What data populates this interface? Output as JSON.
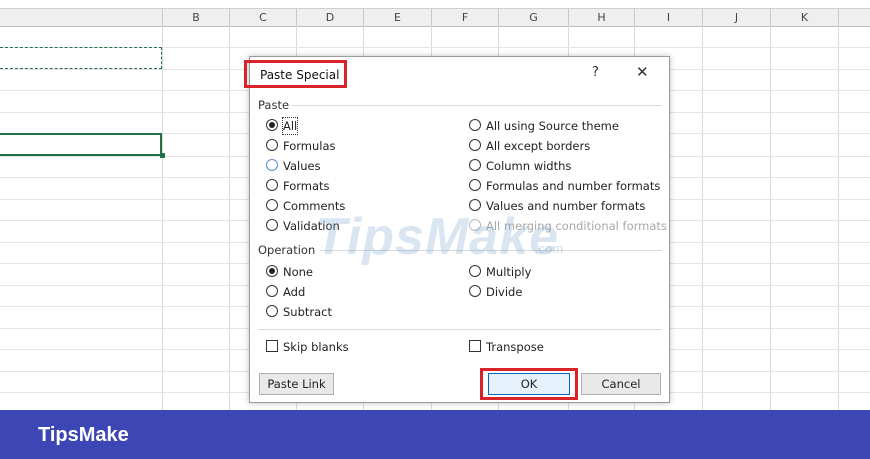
{
  "sheet": {
    "columns": [
      "B",
      "C",
      "D",
      "E",
      "F",
      "G",
      "H",
      "I",
      "J",
      "K"
    ]
  },
  "dialog": {
    "title": "Paste Special",
    "help_label": "?",
    "close_label": "✕",
    "paste_group_label": "Paste",
    "paste_left": [
      "All",
      "Formulas",
      "Values",
      "Formats",
      "Comments",
      "Validation"
    ],
    "paste_right": [
      "All using Source theme",
      "All except borders",
      "Column widths",
      "Formulas and number formats",
      "Values and number formats",
      "All merging conditional formats"
    ],
    "operation_group_label": "Operation",
    "operation_left": [
      "None",
      "Add",
      "Subtract"
    ],
    "operation_right": [
      "Multiply",
      "Divide"
    ],
    "skip_blanks_label": "Skip blanks",
    "transpose_label": "Transpose",
    "paste_link_label": "Paste Link",
    "ok_label": "OK",
    "cancel_label": "Cancel",
    "selected_paste": "All",
    "selected_operation": "None"
  },
  "watermark": {
    "main": "TipsMake",
    "sub": ".com"
  },
  "banner": {
    "text": "TipsMake"
  },
  "colors": {
    "highlight": "#d9232a",
    "banner": "#3c47b5",
    "excel_green": "#217346"
  }
}
